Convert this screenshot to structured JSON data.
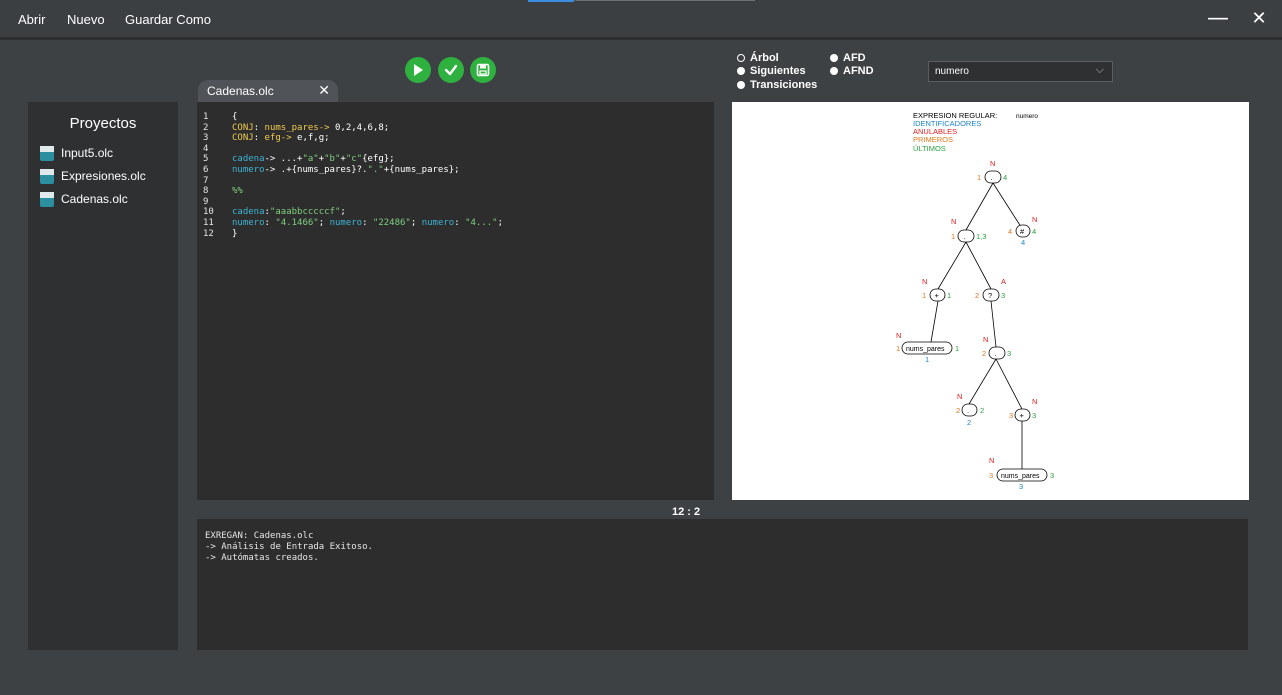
{
  "menu": {
    "open": "Abrir",
    "new": "Nuevo",
    "save_as": "Guardar Como"
  },
  "window": {
    "minimize": "—",
    "close": "✕"
  },
  "toolbar": {
    "run_icon": "play-icon",
    "check_icon": "check-icon",
    "save_icon": "save-icon",
    "color": "#2fb140"
  },
  "tab": {
    "label": "Cadenas.olc",
    "close": "✕"
  },
  "sidebar": {
    "title": "Proyectos",
    "items": [
      {
        "label": "Input5.olc"
      },
      {
        "label": "Expresiones.olc"
      },
      {
        "label": "Cadenas.olc"
      }
    ]
  },
  "editor": {
    "line_numbers": [
      "1",
      "2",
      "3",
      "4",
      "5",
      "6",
      "7",
      "8",
      "9",
      "10",
      "11",
      "12"
    ],
    "cursor": "12 : 2"
  },
  "console": {
    "lines": [
      "EXREGAN: Cadenas.olc",
      "-> Análisis de Entrada Exitoso.",
      "-> Autómatas creados."
    ]
  },
  "view_options": {
    "arbol": "Árbol",
    "siguientes": "Siguientes",
    "transiciones": "Transiciones",
    "afd": "AFD",
    "afnd": "AFND"
  },
  "expression_select": {
    "value": "numero"
  },
  "tree_legend": {
    "title": "EXPRESION REGULAR:",
    "title_value": "numero",
    "identificadores": "IDENTIFICADORES",
    "anulables": "ANULABLES",
    "primeros": "PRIMEROS",
    "ultimos": "ÚLTIMOS"
  },
  "tree": {
    "nodes": {
      "root": {
        "label": ".",
        "first": "1",
        "last": "4",
        "null": "N"
      },
      "hash": {
        "label": "#",
        "first": "4",
        "last": "4",
        "null": "N",
        "id": "4"
      },
      "dot2": {
        "label": ".",
        "first": "1",
        "last": "1,3",
        "null": "N"
      },
      "plus1": {
        "label": "+",
        "first": "1",
        "last": "1",
        "null": "N"
      },
      "opt": {
        "label": "?",
        "first": "2",
        "last": "3",
        "null": "A"
      },
      "leaf1": {
        "label": "nums_pares",
        "first": "1",
        "last": "1",
        "null": "N",
        "id": "1"
      },
      "dot3": {
        "label": ".",
        "first": "2",
        "last": "3",
        "null": "N"
      },
      "dotchar": {
        "label": ".",
        "first": "2",
        "last": "2",
        "null": "N",
        "id": "2"
      },
      "plus2": {
        "label": "+",
        "first": "3",
        "last": "3",
        "null": "N"
      },
      "leaf3": {
        "label": "nums_pares",
        "first": "3",
        "last": "3",
        "null": "N",
        "id": "3"
      }
    }
  }
}
